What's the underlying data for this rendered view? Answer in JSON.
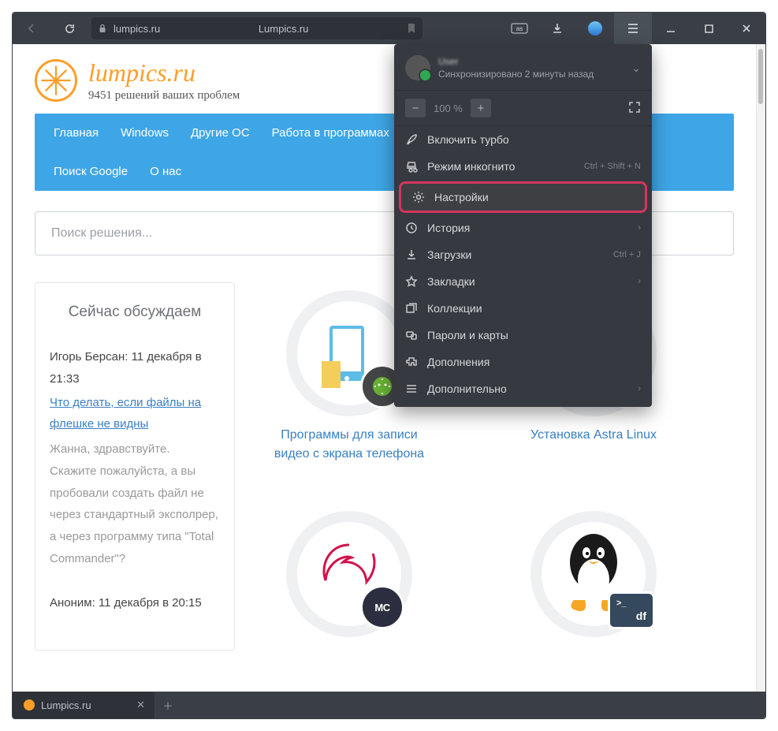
{
  "browser": {
    "address_host": "lumpics.ru",
    "page_title": "Lumpics.ru",
    "tab_title": "Lumpics.ru"
  },
  "menu": {
    "profile_name": "User",
    "sync_status": "Синхронизировано 2 минуты назад",
    "zoom": "100 %",
    "items": {
      "turbo": {
        "label": "Включить турбо"
      },
      "incognito": {
        "label": "Режим инкогнито",
        "shortcut": "Ctrl + Shift + N"
      },
      "settings": {
        "label": "Настройки"
      },
      "history": {
        "label": "История"
      },
      "downloads": {
        "label": "Загрузки",
        "shortcut": "Ctrl + J"
      },
      "bookmarks": {
        "label": "Закладки"
      },
      "collections": {
        "label": "Коллекции"
      },
      "passwords": {
        "label": "Пароли и карты"
      },
      "addons": {
        "label": "Дополнения"
      },
      "more": {
        "label": "Дополнительно"
      }
    }
  },
  "site": {
    "title": "lumpics.ru",
    "subtitle": "9451 решений ваших проблем",
    "nav": [
      "Главная",
      "Windows",
      "Другие ОС",
      "Работа в программах",
      "Поиск Google",
      "О нас"
    ],
    "search_placeholder": "Поиск решения...",
    "sidebar_title": "Сейчас обсуждаем",
    "comments": [
      {
        "author": "Игорь Берсан: 11 декабря в 21:33",
        "link": "Что делать, если файлы на флешке не видны",
        "text": "Жанна, здравствуйте. Скажите пожалуйста, а вы пробовали создать файл не через стандартный эксполрер, а через программу типа \"Total Commander\"?"
      },
      {
        "author": "Аноним: 11 декабря в 20:15",
        "link": "",
        "text": ""
      }
    ],
    "cards": [
      {
        "caption": "Программы для записи видео с экрана телефона",
        "badge": ""
      },
      {
        "caption": "Установка Astra Linux",
        "badge": ""
      },
      {
        "caption": "",
        "badge": "MC"
      },
      {
        "caption": "",
        "badge": "df"
      }
    ]
  }
}
